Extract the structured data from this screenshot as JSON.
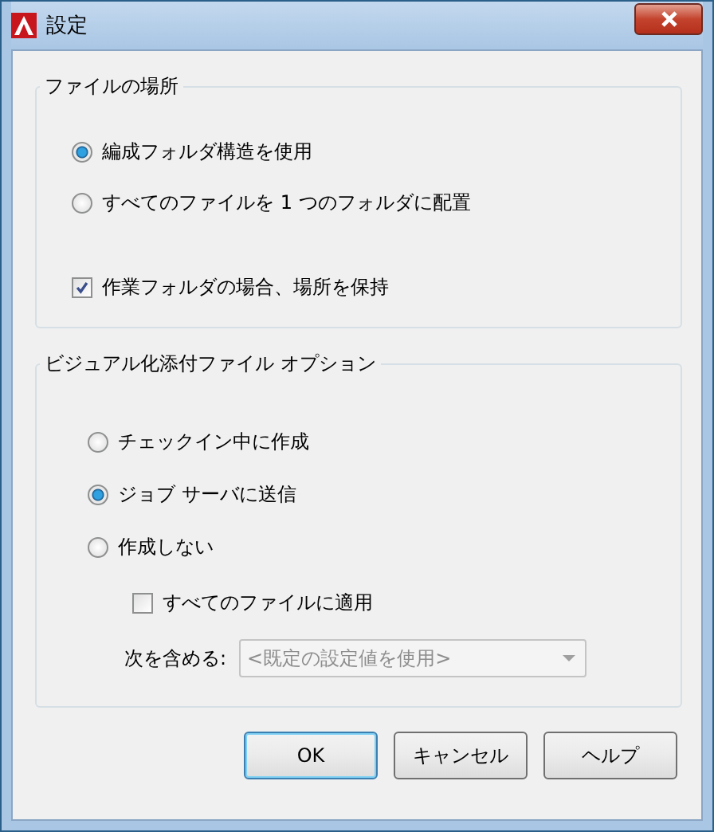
{
  "window": {
    "title": "設定"
  },
  "file_location": {
    "title": "ファイルの場所",
    "radios": [
      {
        "label": "編成フォルダ構造を使用",
        "selected": true
      },
      {
        "label": "すべてのファイルを 1 つのフォルダに配置",
        "selected": false
      }
    ],
    "checkbox": {
      "label": "作業フォルダの場合、場所を保持",
      "checked": true
    }
  },
  "visualization": {
    "title": "ビジュアル化添付ファイル オプション",
    "radios": [
      {
        "label": "チェックイン中に作成",
        "selected": false
      },
      {
        "label": "ジョブ サーバに送信",
        "selected": true
      },
      {
        "label": "作成しない",
        "selected": false
      }
    ],
    "checkbox": {
      "label": "すべてのファイルに適用",
      "checked": false
    },
    "include": {
      "label": "次を含める:",
      "value": "<既定の設定値を使用>",
      "disabled": true
    }
  },
  "buttons": [
    {
      "label": "OK",
      "default": true
    },
    {
      "label": "キャンセル",
      "default": false
    },
    {
      "label": "ヘルプ",
      "default": false
    }
  ]
}
